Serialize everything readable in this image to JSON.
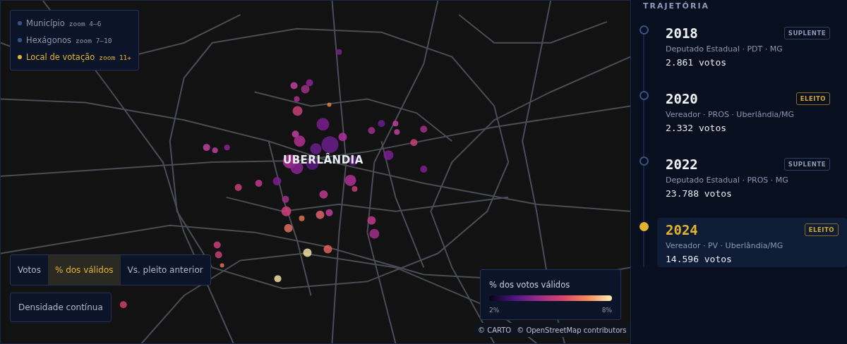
{
  "map": {
    "city_label": "UBERLÂNDIA",
    "layers": [
      {
        "name": "Município",
        "zoom": "zoom 4–6",
        "selected": false
      },
      {
        "name": "Hexágonos",
        "zoom": "zoom 7–10",
        "selected": false
      },
      {
        "name": "Local de votação",
        "zoom": "zoom 11+",
        "selected": true
      }
    ],
    "modes": [
      {
        "label": "Votos",
        "selected": false
      },
      {
        "label": "% dos válidos",
        "selected": true
      },
      {
        "label": "Vs. pleito anterior",
        "selected": false
      }
    ],
    "density_button": "Densidade contínua",
    "color_legend": {
      "title": "% dos votos válidos",
      "min": "2%",
      "max": "8%"
    },
    "attribution": [
      "© CARTO",
      "© OpenStreetMap contributors"
    ]
  },
  "trajectory": {
    "title": "TRAJETÓRIA",
    "items": [
      {
        "year": "2018",
        "role": "Deputado Estadual · PDT · MG",
        "votes": "2.861 votos",
        "badge": "SUPLENTE",
        "kind": "suplente",
        "selected": false
      },
      {
        "year": "2020",
        "role": "Vereador · PROS · Uberlândia/MG",
        "votes": "2.332 votos",
        "badge": "ELEITO",
        "kind": "eleito",
        "selected": false
      },
      {
        "year": "2022",
        "role": "Deputado Estadual · PROS · MG",
        "votes": "23.788 votos",
        "badge": "SUPLENTE",
        "kind": "suplente",
        "selected": false
      },
      {
        "year": "2024",
        "role": "Vereador · PV · Uberlândia/MG",
        "votes": "14.596 votos",
        "badge": "ELEITO",
        "kind": "eleito",
        "selected": true
      }
    ]
  }
}
